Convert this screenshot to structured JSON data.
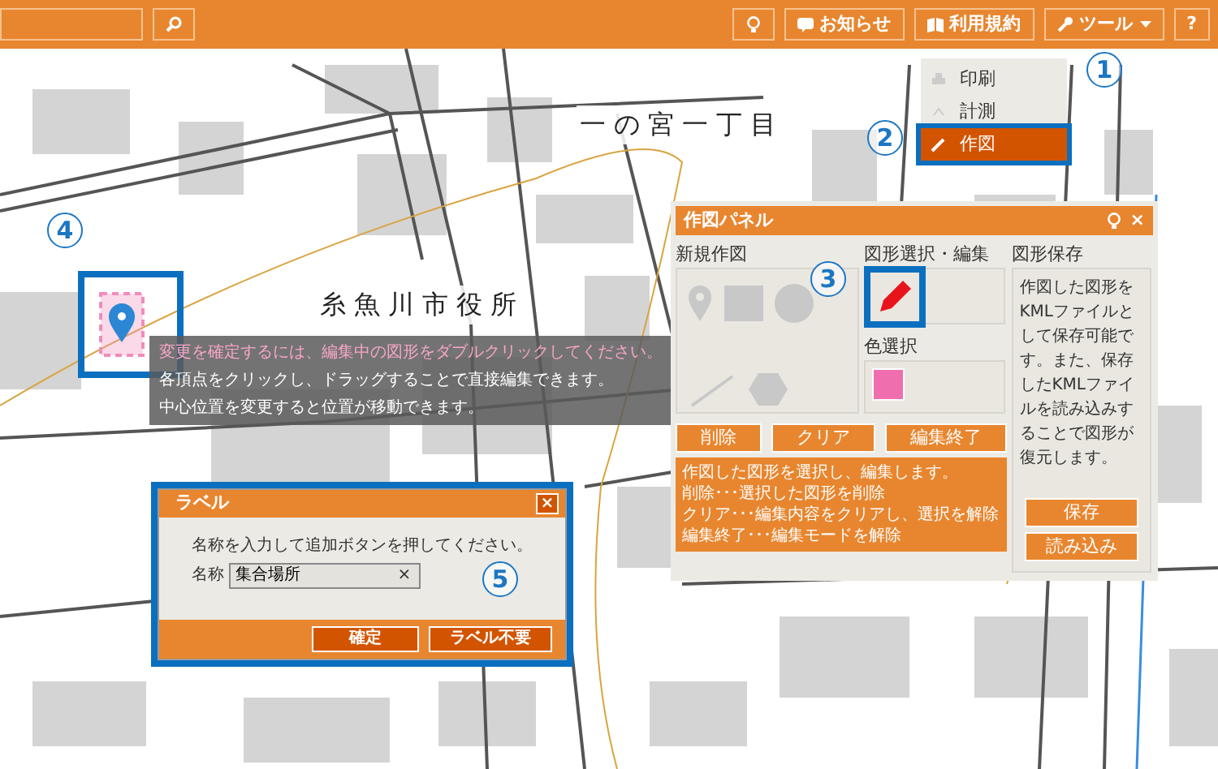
{
  "toolbar": {
    "buttons": [
      {
        "kind": "bulb"
      },
      {
        "kind": "notice",
        "label": "お知らせ"
      },
      {
        "kind": "terms",
        "label": "利用規約"
      },
      {
        "kind": "tools",
        "label": "ツール"
      },
      {
        "kind": "help",
        "label": "?"
      }
    ]
  },
  "tools_menu": {
    "items": [
      {
        "kind": "print",
        "label": "印刷",
        "selected": false
      },
      {
        "kind": "measure",
        "label": "計測",
        "selected": false
      },
      {
        "kind": "draw",
        "label": "作図",
        "selected": true
      }
    ]
  },
  "map_labels": [
    "一の宮一丁目",
    "糸魚川市役所"
  ],
  "callouts": [
    "1",
    "2",
    "3",
    "4",
    "5"
  ],
  "tooltip": {
    "lines": [
      "変更を確定するには、編集中の図形をダブルクリックしてください。",
      "各頂点をクリックし、ドラッグすることで直接編集できます。",
      "中心位置を変更すると位置が移動できます。"
    ]
  },
  "drawing_panel": {
    "title": "作図パネル",
    "close": "×",
    "new_shape_label": "新規作図",
    "select_edit_label": "図形選択・編集",
    "color_label": "色選択",
    "color": "#ef6fae",
    "save_label": "図形保存",
    "buttons": [
      "削除",
      "クリア",
      "編集終了"
    ],
    "help_lines": [
      "作図した図形を選択し、編集します。",
      "削除･･･選択した図形を削除",
      "クリア･･･編集内容をクリアし、選択を解除",
      "編集終了･･･編集モードを解除"
    ],
    "save_text": "作図した図形をKMLファイルとして保存可能です。また、保存したKMLファイルを読み込みすることで図形が復元します。",
    "save_buttons": [
      "保存",
      "読み込み"
    ]
  },
  "label_dialog": {
    "title": "ラベル",
    "close": "×",
    "clear": "×",
    "message": "名称を入力して追加ボタンを押してください。",
    "field_label": "名称",
    "value": "集合場所",
    "buttons": [
      "確定",
      "ラベル不要"
    ]
  }
}
